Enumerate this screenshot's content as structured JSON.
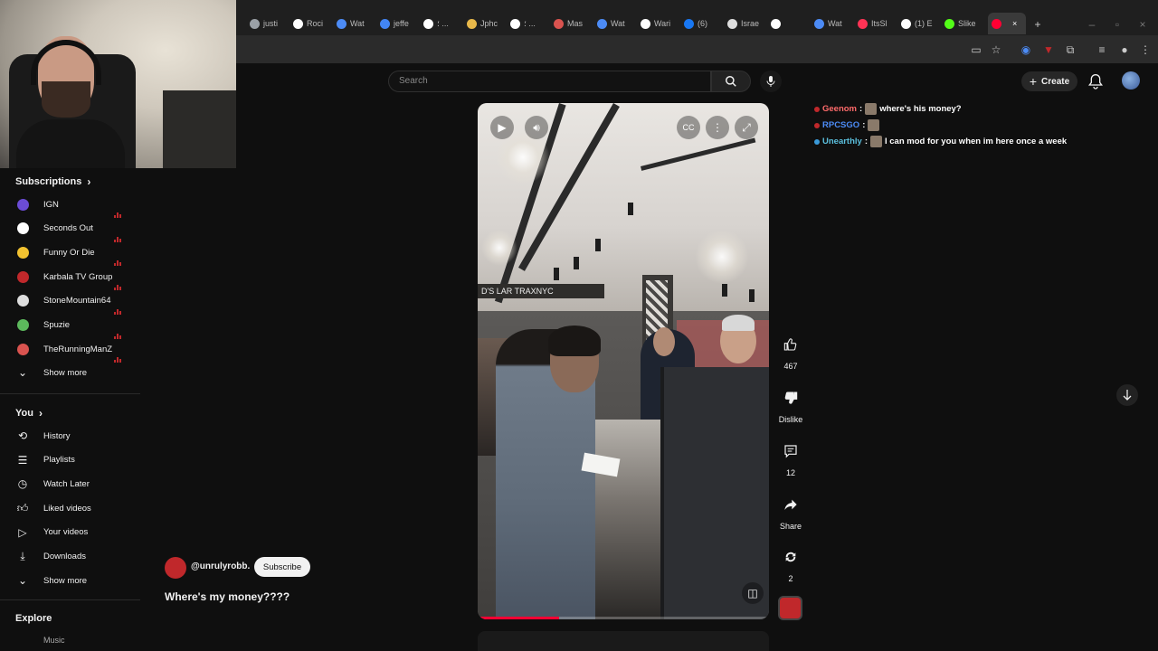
{
  "browser": {
    "tabs": [
      {
        "label": "justi",
        "color": "#9aa0a6"
      },
      {
        "label": "Roci",
        "color": "#ffffff"
      },
      {
        "label": "Wat",
        "color": "#4c8bf5"
      },
      {
        "label": "jeffe",
        "color": "#4285f4"
      },
      {
        "label": "؛ ...",
        "color": "#ffffff"
      },
      {
        "label": "Jphc",
        "color": "#e8b84a"
      },
      {
        "label": "؛ ...",
        "color": "#ffffff"
      },
      {
        "label": "Mas",
        "color": "#d9534f"
      },
      {
        "label": "Wat",
        "color": "#4c8bf5"
      },
      {
        "label": "Wari",
        "color": "#ffffff"
      },
      {
        "label": "(6) ",
        "color": "#1877f2"
      },
      {
        "label": "Israe",
        "color": "#dddddd"
      },
      {
        "label": "",
        "color": "#ffffff"
      },
      {
        "label": "Wat",
        "color": "#4c8bf5"
      },
      {
        "label": "ItsSl",
        "color": "#ff3355"
      },
      {
        "label": "(1) E",
        "color": "#ffffff"
      },
      {
        "label": "Slike",
        "color": "#53fc18"
      },
      {
        "label": "",
        "color": "#ff0033"
      }
    ]
  },
  "header": {
    "search_placeholder": "Search",
    "create_label": "Create"
  },
  "sidebar": {
    "subscriptions_title": "Subscriptions",
    "subscriptions": [
      {
        "label": "IGN",
        "color": "#6b4cd6"
      },
      {
        "label": "Seconds Out",
        "color": "#ffffff"
      },
      {
        "label": "Funny Or Die",
        "color": "#f2c230"
      },
      {
        "label": "Karbala TV Group",
        "color": "#c0282b"
      },
      {
        "label": "StoneMountain64",
        "color": "#dddddd"
      },
      {
        "label": "Spuzie",
        "color": "#5cb85c"
      },
      {
        "label": "TheRunningManZ",
        "color": "#d9534f"
      }
    ],
    "show_more_1": "Show more",
    "you_title": "You",
    "you_items": [
      {
        "label": "History",
        "icon": "history-icon"
      },
      {
        "label": "Playlists",
        "icon": "playlists-icon"
      },
      {
        "label": "Watch Later",
        "icon": "clock-icon"
      },
      {
        "label": "Liked videos",
        "icon": "thumbs-up-icon"
      },
      {
        "label": "Your videos",
        "icon": "play-square-icon"
      },
      {
        "label": "Downloads",
        "icon": "download-icon"
      }
    ],
    "show_more_2": "Show more",
    "explore_title": "Explore",
    "explore_peek": "Music"
  },
  "short": {
    "channel": "@unrulyrobb.",
    "subscribe_label": "Subscribe",
    "title": "Where's my money????",
    "video_sign": "D'S LAR  TRAXNYC",
    "progress": 0.28,
    "actions": {
      "likes": "467",
      "dislike_label": "Dislike",
      "comments": "12",
      "share_label": "Share",
      "remix": "2"
    }
  },
  "chat": [
    {
      "user": "Geenom",
      "color": "#ff6b6b",
      "badge": "#c0282b",
      "text": "where's his money?"
    },
    {
      "user": "RPCSGO",
      "color": "#4c8bf5",
      "badge": "#c0282b",
      "text": ""
    },
    {
      "user": "Unearthly",
      "color": "#5bc0de",
      "badge": "#3a9ad9",
      "text": "I can mod for you when im here once a week"
    }
  ]
}
